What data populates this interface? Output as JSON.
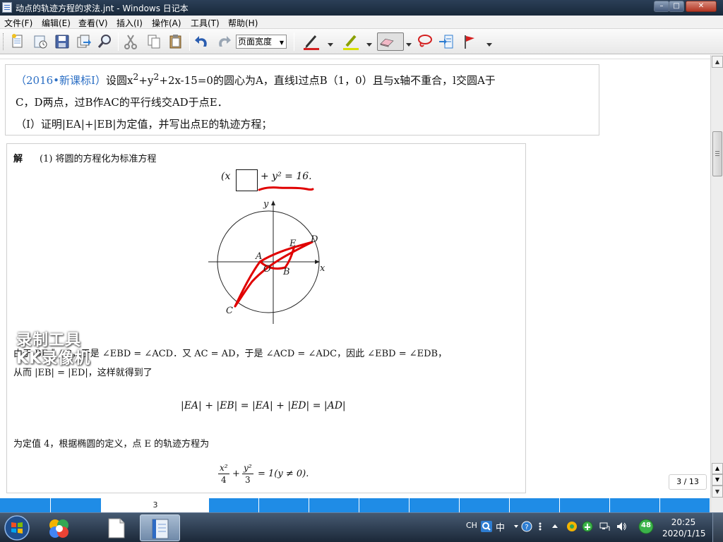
{
  "window": {
    "title": "动点的轨迹方程的求法.jnt - Windows 日记本",
    "min_label": "–",
    "max_label": "□",
    "close_label": "✕"
  },
  "menu": [
    "文件(F)",
    "编辑(E)",
    "查看(V)",
    "插入(I)",
    "操作(A)",
    "工具(T)",
    "帮助(H)"
  ],
  "toolbar": {
    "zoom_value": "页面宽度",
    "buttons": [
      "new-page-icon",
      "new-note-icon",
      "save-icon",
      "export-icon",
      "find-icon",
      "cut-icon",
      "copy-icon",
      "paste-icon",
      "undo-icon",
      "redo-icon",
      "pen-icon",
      "highlighter-icon",
      "eraser-icon",
      "lasso-icon",
      "insert-space-icon",
      "flag-icon"
    ],
    "pen_color": "#d42020",
    "highlighter_color": "#d8e000",
    "flag_color": "#d42020"
  },
  "problem": {
    "source": "（2016•新课标Ⅰ）",
    "line1_a": "设圆x",
    "sup1": "2",
    "line1_b": "+y",
    "sup2": "2",
    "line1_c": "+2x-15=0的圆心为A，直线l过点B（1，0）且与x轴不重合，l交圆A于",
    "line2": "C，D两点，过B作AC的平行线交AD于点E．",
    "line3": "（Ⅰ）证明|EA|+|EB|为定值，并写出点E的轨迹方程；"
  },
  "solution": {
    "label": "解",
    "step1": "(1) 将圆的方程化为标准方程",
    "eq1_left": "(x",
    "eq1_right": "+ y² = 16.",
    "diagram": {
      "axis_x": "x",
      "axis_y": "y",
      "point_A": "A",
      "point_O": "O",
      "point_B": "B",
      "point_C": "C",
      "point_D": "D",
      "point_E": "E"
    },
    "reason1": "由于 BE ∥ AC，于是 ∠EBD = ∠ACD．又 AC = AD，于是 ∠ACD = ∠ADC，因此 ∠EBD = ∠EDB，",
    "reason2": "从而 |EB| = |ED|，这样就得到了",
    "eq2": "|EA| + |EB| = |EA| + |ED| = |AD|",
    "conclusion": "为定值 4，根据椭圆的定义，点 E 的轨迹方程为",
    "eq3_x2": "x²",
    "eq3_4": "4",
    "eq3_y2": "y²",
    "eq3_3": "3",
    "eq3_tail": "= 1(y ≠ 0).",
    "ink_color": "#e00000"
  },
  "watermark": {
    "line1": "录制工具",
    "line2": "KK录像机"
  },
  "page_counter": "3 / 13",
  "page_tab_current": "3",
  "taskbar": {
    "ime_label": "CH",
    "ime_mode": "中",
    "badge_number": "48",
    "time": "20:25",
    "date": "2020/1/15"
  }
}
